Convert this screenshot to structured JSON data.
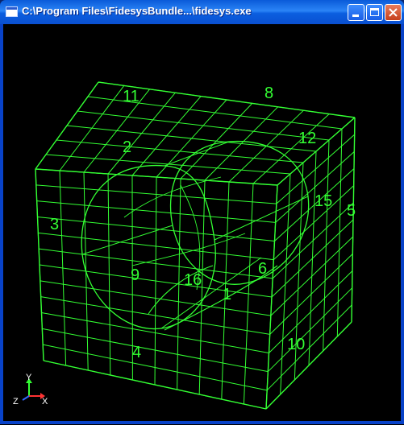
{
  "window": {
    "title": "C:\\Program Files\\FidesysBundle...\\fidesys.exe",
    "icon": "app-window-icon"
  },
  "controls": {
    "minimize_icon": "minimize-icon",
    "maximize_icon": "maximize-icon",
    "close_icon": "close-icon"
  },
  "viewport": {
    "background": "#000000",
    "mesh_color": "#33ff33",
    "labels": [
      "11",
      "8",
      "2",
      "12",
      "15",
      "5",
      "3",
      "9",
      "16",
      "6",
      "1",
      "4",
      "10"
    ]
  },
  "triad": {
    "y_label": "Y",
    "z_label": "Z",
    "x_label": "X",
    "y_color": "#33ff33",
    "x_color": "#ff3333",
    "z_color": "#3366ff"
  }
}
